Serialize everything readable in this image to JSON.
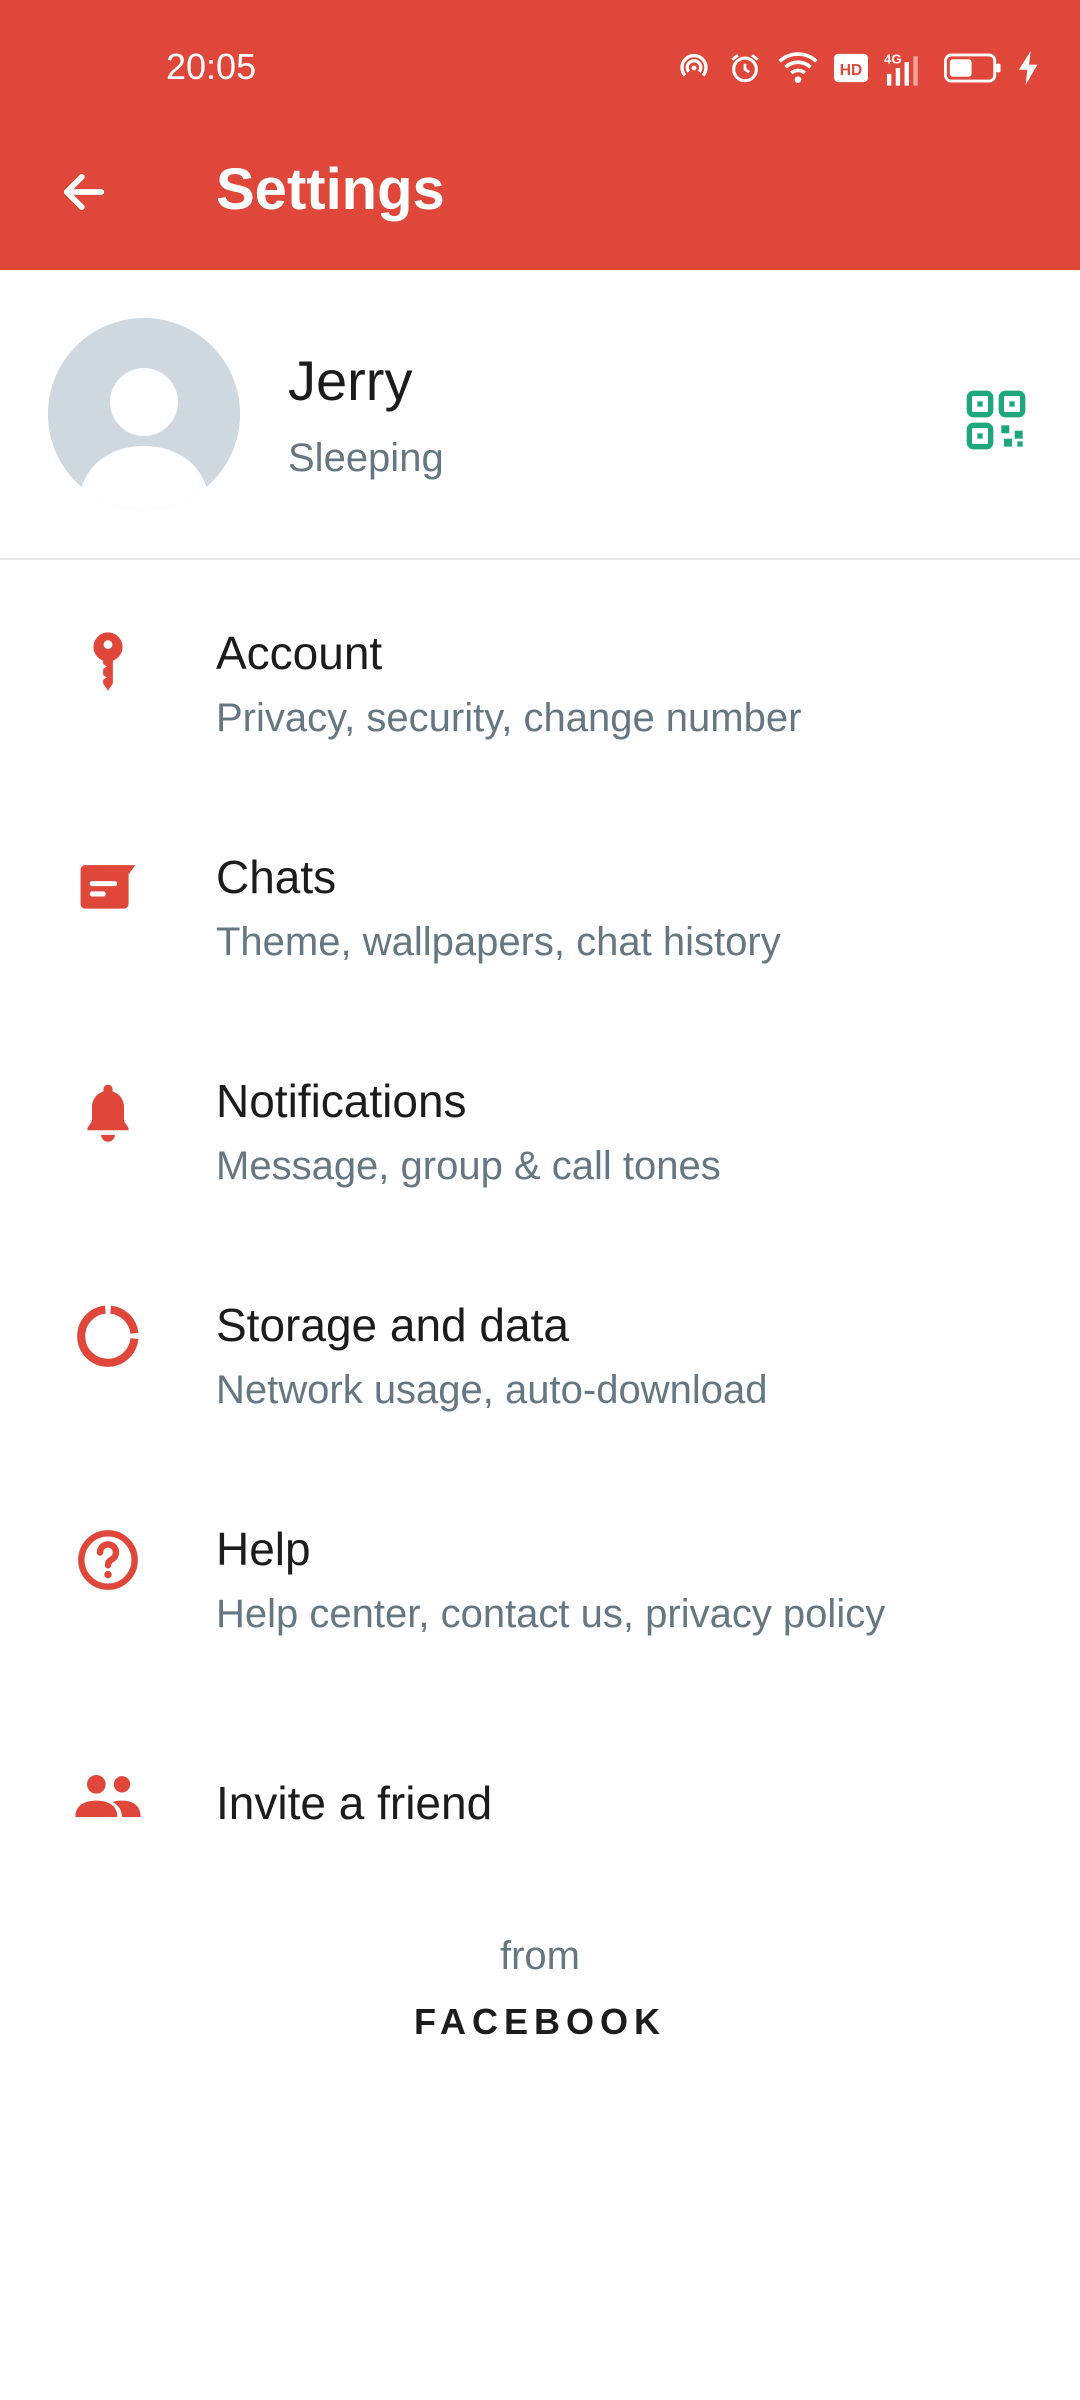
{
  "status_bar": {
    "time": "20:05",
    "icons": [
      "hotspot-icon",
      "alarm-icon",
      "wifi-icon",
      "hd-icon",
      "4g-signal-icon",
      "battery-icon",
      "charging-icon"
    ]
  },
  "header": {
    "title": "Settings",
    "background": "#df473a"
  },
  "profile": {
    "name": "Jerry",
    "status": "Sleeping",
    "qr_color": "#1fa67a"
  },
  "menu": [
    {
      "label": "Account",
      "sub": "Privacy, security, change number",
      "icon": "key-icon"
    },
    {
      "label": "Chats",
      "sub": "Theme, wallpapers, chat history",
      "icon": "chat-icon"
    },
    {
      "label": "Notifications",
      "sub": "Message, group & call tones",
      "icon": "bell-icon"
    },
    {
      "label": "Storage and data",
      "sub": "Network usage, auto-download",
      "icon": "storage-icon"
    },
    {
      "label": "Help",
      "sub": "Help center, contact us, privacy policy",
      "icon": "help-icon"
    },
    {
      "label": "Invite a friend",
      "icon": "people-icon"
    }
  ],
  "footer": {
    "from": "from",
    "brand": "FACEBOOK"
  },
  "colors": {
    "accent": "#df473a",
    "secondary_text": "#667781"
  }
}
